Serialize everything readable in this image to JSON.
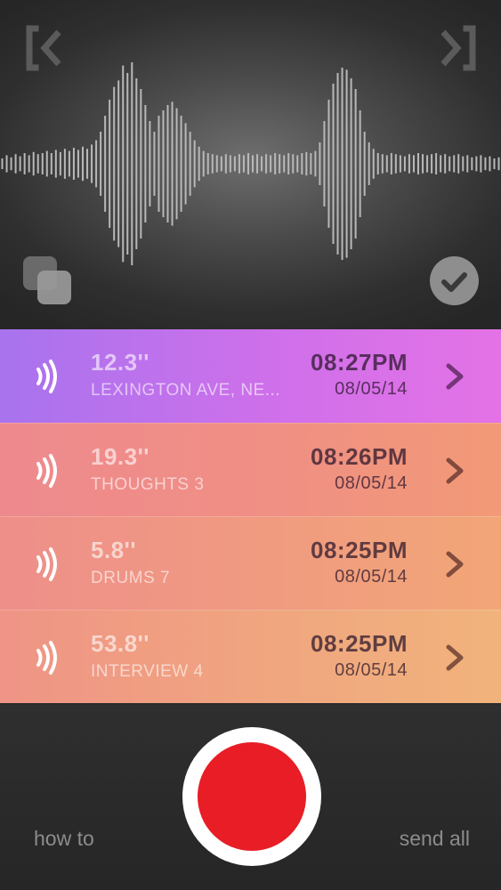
{
  "waveform": {
    "player": {
      "prev_icon": "skip-back-bracket-icon",
      "next_icon": "skip-forward-bracket-icon",
      "copy_icon": "duplicate-icon",
      "confirm_icon": "checkmark-circle-icon"
    },
    "amplitudes": [
      0.05,
      0.08,
      0.06,
      0.09,
      0.07,
      0.1,
      0.08,
      0.11,
      0.09,
      0.1,
      0.12,
      0.1,
      0.13,
      0.11,
      0.14,
      0.12,
      0.15,
      0.13,
      0.16,
      0.14,
      0.18,
      0.22,
      0.3,
      0.45,
      0.6,
      0.72,
      0.78,
      0.92,
      0.85,
      0.95,
      0.8,
      0.7,
      0.55,
      0.4,
      0.3,
      0.45,
      0.5,
      0.55,
      0.58,
      0.52,
      0.45,
      0.38,
      0.3,
      0.22,
      0.16,
      0.12,
      0.1,
      0.09,
      0.08,
      0.07,
      0.09,
      0.08,
      0.07,
      0.09,
      0.08,
      0.1,
      0.08,
      0.09,
      0.07,
      0.09,
      0.08,
      0.1,
      0.09,
      0.08,
      0.1,
      0.09,
      0.08,
      0.1,
      0.11,
      0.1,
      0.12,
      0.2,
      0.4,
      0.6,
      0.75,
      0.85,
      0.9,
      0.88,
      0.8,
      0.7,
      0.5,
      0.3,
      0.2,
      0.14,
      0.1,
      0.09,
      0.08,
      0.1,
      0.09,
      0.08,
      0.07,
      0.09,
      0.08,
      0.1,
      0.09,
      0.08,
      0.09,
      0.1,
      0.08,
      0.09,
      0.07,
      0.08,
      0.09,
      0.07,
      0.08,
      0.06,
      0.07,
      0.08,
      0.06,
      0.07,
      0.05,
      0.06
    ]
  },
  "recordings": [
    {
      "duration": "12.3''",
      "title": "LEXINGTON AVE, NE...",
      "time": "08:27PM",
      "date": "08/05/14",
      "play_icon": "sound-waves-icon",
      "chevron_icon": "chevron-right-icon",
      "color": "#c471eb"
    },
    {
      "duration": "19.3''",
      "title": "THOUGHTS 3",
      "time": "08:26PM",
      "date": "08/05/14",
      "play_icon": "sound-waves-icon",
      "chevron_icon": "chevron-right-icon",
      "color": "#f08f84"
    },
    {
      "duration": "5.8''",
      "title": "DRUMS 7",
      "time": "08:25PM",
      "date": "08/05/14",
      "play_icon": "sound-waves-icon",
      "chevron_icon": "chevron-right-icon",
      "color": "#f09b80"
    },
    {
      "duration": "53.8''",
      "title": "INTERVIEW 4",
      "time": "08:25PM",
      "date": "08/05/14",
      "play_icon": "sound-waves-icon",
      "chevron_icon": "chevron-right-icon",
      "color": "#f0a67f"
    }
  ],
  "footer": {
    "how_to": "how to",
    "send_all": "send all",
    "record_icon": "record-button-icon",
    "record_color": "#e81d25"
  }
}
